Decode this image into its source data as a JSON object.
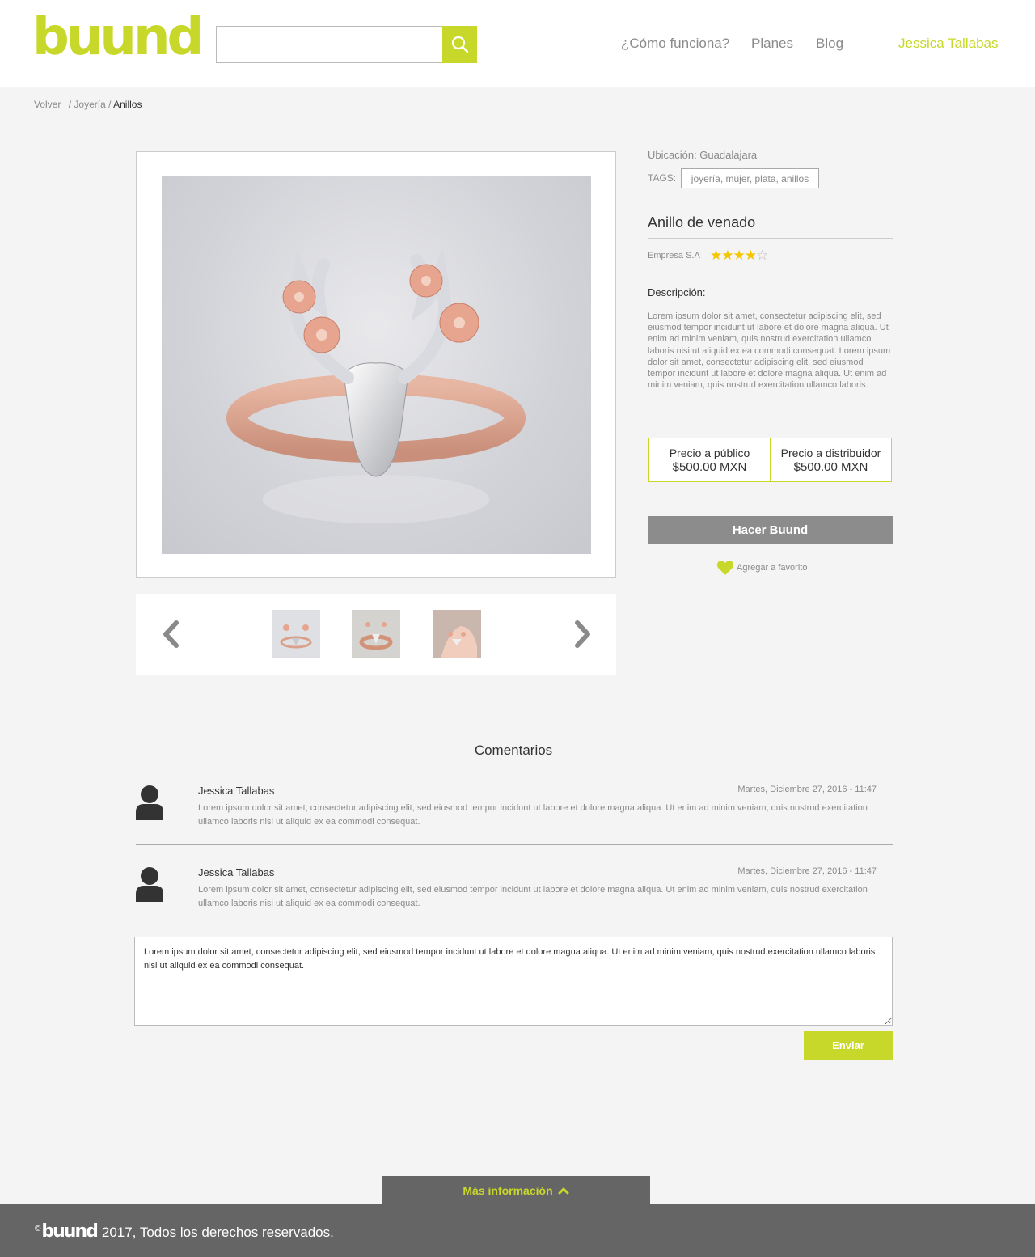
{
  "header": {
    "logo": "buund",
    "search_placeholder": "",
    "nav": [
      "¿Cómo funciona?",
      "Planes",
      "Blog"
    ],
    "user_name": "Jessica Tallabas"
  },
  "breadcrumb": {
    "back": "Volver",
    "sep1": "/",
    "category": "Joyería",
    "sep2": "/",
    "current": "Anillos"
  },
  "product": {
    "location": "Ubicación: Guadalajara",
    "tags_label": "TAGS:",
    "tags": "joyería, mujer, plata, anillos",
    "title": "Anillo de venado",
    "company": "Empresa S.A",
    "rating": 4,
    "rating_max": 5,
    "description_label": "Descripción:",
    "description": "Lorem ipsum dolor sit amet, consectetur adipiscing elit, sed eiusmod tempor incidunt ut labore et dolore magna aliqua. Ut enim ad minim veniam, quis nostrud exercitation ullamco laboris nisi ut aliquid ex ea commodi consequat. Lorem ipsum dolor sit amet, consectetur adipiscing elit, sed eiusmod tempor incidunt ut labore et dolore magna aliqua. Ut enim ad minim veniam, quis nostrud exercitation ullamco laboris.",
    "price_public_label": "Precio a público",
    "price_public": "$500.00 MXN",
    "price_dist_label": "Precio a distribuidor",
    "price_dist": "$500.00 MXN",
    "cta": "Hacer Buund",
    "favorite": "Agregar a favorito"
  },
  "comments": {
    "title": "Comentarios",
    "items": [
      {
        "author": "Jessica Tallabas",
        "date": "Martes, Diciembre 27, 2016 - 11:47",
        "text": "Lorem ipsum dolor sit amet, consectetur adipiscing elit, sed eiusmod tempor incidunt ut labore et dolore magna aliqua. Ut enim ad minim veniam, quis nostrud exercitation ullamco laboris nisi ut aliquid ex ea commodi consequat."
      },
      {
        "author": "Jessica Tallabas",
        "date": "Martes, Diciembre 27, 2016 - 11:47",
        "text": "Lorem ipsum dolor sit amet, consectetur adipiscing elit, sed eiusmod tempor incidunt ut labore et dolore magna aliqua. Ut enim ad minim veniam, quis nostrud exercitation ullamco laboris nisi ut aliquid ex ea commodi consequat."
      }
    ],
    "input_value": "Lorem ipsum dolor sit amet, consectetur adipiscing elit, sed eiusmod tempor incidunt ut labore et dolore magna aliqua. Ut enim ad minim veniam, quis nostrud exercitation ullamco laboris nisi ut aliquid ex ea commodi consequat.",
    "send": "Enviar"
  },
  "footer": {
    "more_info": "Más información",
    "copyright_symbol": "©",
    "logo": "buund",
    "copyright_text": "2017, Todos los derechos reservados."
  },
  "colors": {
    "accent": "#c8d82a",
    "footer_bg": "#666566",
    "button_gray": "#8c8c8c",
    "star": "#f5c500"
  },
  "icons": {
    "search": "search-icon",
    "prev": "chevron-left-icon",
    "next": "chevron-right-icon",
    "favorite": "heart-icon",
    "user": "user-avatar-icon",
    "expand": "chevron-up-icon"
  }
}
